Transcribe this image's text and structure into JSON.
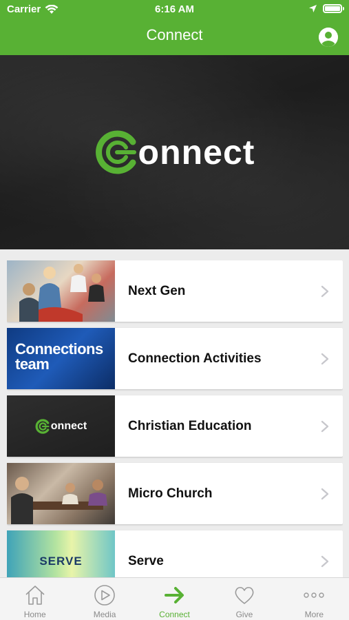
{
  "status_bar": {
    "carrier": "Carrier",
    "time": "6:16 AM"
  },
  "nav": {
    "title": "Connect"
  },
  "hero": {
    "logo_text": "onnect"
  },
  "items": [
    {
      "title": "Next Gen"
    },
    {
      "title": "Connection Activities",
      "thumb_text": "Connections team"
    },
    {
      "title": "Christian Education",
      "thumb_text": "onnect"
    },
    {
      "title": "Micro Church"
    },
    {
      "title": "Serve",
      "thumb_text": "SERVE"
    }
  ],
  "tabs": [
    {
      "label": "Home",
      "icon": "house-icon"
    },
    {
      "label": "Media",
      "icon": "play-icon"
    },
    {
      "label": "Connect",
      "icon": "arrow-right-icon",
      "active": true
    },
    {
      "label": "Give",
      "icon": "heart-icon"
    },
    {
      "label": "More",
      "icon": "ellipsis-icon"
    }
  ],
  "colors": {
    "brand_green": "#58b134",
    "tab_inactive": "#8a8a8a"
  }
}
